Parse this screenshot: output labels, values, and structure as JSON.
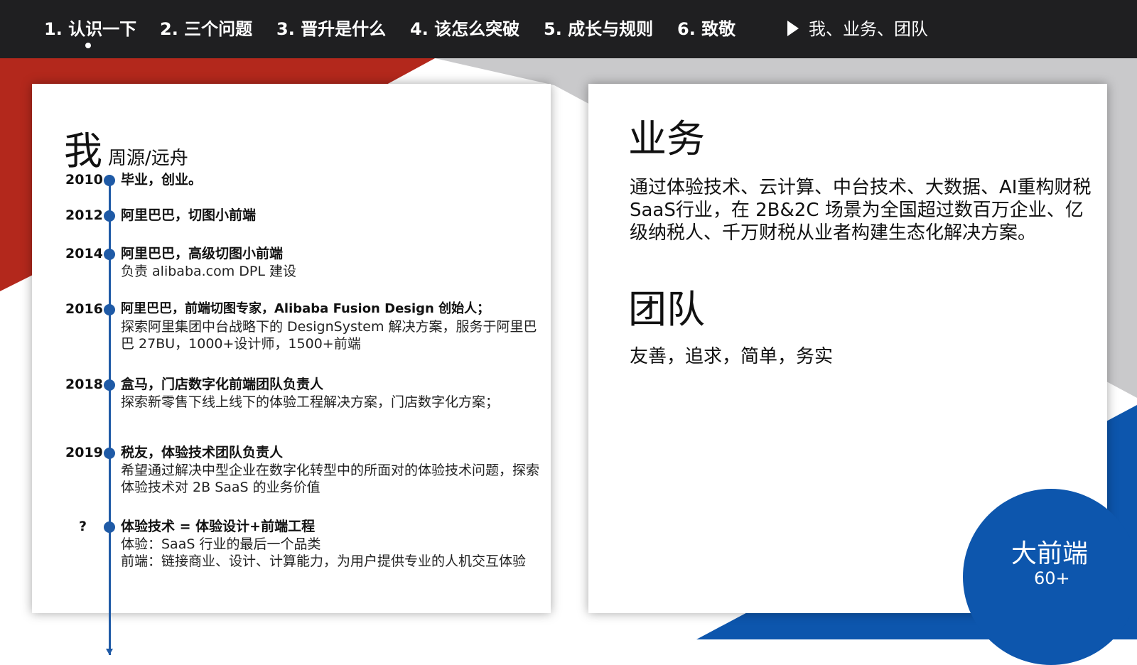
{
  "nav": {
    "items": [
      {
        "label": "1. 认识一下"
      },
      {
        "label": "2. 三个问题"
      },
      {
        "label": "3. 晋升是什么"
      },
      {
        "label": "4. 该怎么突破"
      },
      {
        "label": "5. 成长与规则"
      },
      {
        "label": "6. 致敬"
      }
    ],
    "current": "我、业务、团队"
  },
  "me": {
    "title": "我",
    "name": "周源/远舟",
    "timeline": [
      {
        "year": "2010",
        "head": "毕业，创业。",
        "desc": ""
      },
      {
        "year": "2012",
        "head": "阿里巴巴，切图小前端",
        "desc": ""
      },
      {
        "year": "2014",
        "head": "阿里巴巴，高级切图小前端",
        "desc": "负责 alibaba.com DPL 建设"
      },
      {
        "year": "2016",
        "head": "阿里巴巴，前端切图专家，Alibaba Fusion Design 创始人；",
        "desc": "探索阿里集团中台战略下的 DesignSystem 解决方案，服务于阿里巴巴 27BU，1000+设计师，1500+前端"
      },
      {
        "year": "2018",
        "head": "盒马，门店数字化前端团队负责人",
        "desc": "探索新零售下线上线下的体验工程解决方案，门店数字化方案；"
      },
      {
        "year": "2019",
        "head": "税友，体验技术团队负责人",
        "desc": "希望通过解决中型企业在数字化转型中的所面对的体验技术问题，探索体验技术对 2B SaaS 的业务价值"
      },
      {
        "year": "?",
        "head": "体验技术 = 体验设计+前端工程",
        "desc": "体验：SaaS 行业的最后一个品类\n前端：链接商业、设计、计算能力，为用户提供专业的人机交互体验"
      }
    ]
  },
  "business": {
    "title": "业务",
    "text": "通过体验技术、云计算、中台技术、大数据、AI重构财税SaaS行业，在 2B&2C 场景为全国超过数百万企业、亿级纳税人、千万财税从业者构建生态化解决方案。"
  },
  "team": {
    "title": "团队",
    "text": "友善，追求，简单，务实"
  },
  "badge": {
    "label": "大前端",
    "count": "60+"
  },
  "colors": {
    "nav_bg": "#1f1f21",
    "accent_red": "#b3281c",
    "accent_blue": "#0d56ad",
    "timeline_blue": "#1f5aa6"
  }
}
